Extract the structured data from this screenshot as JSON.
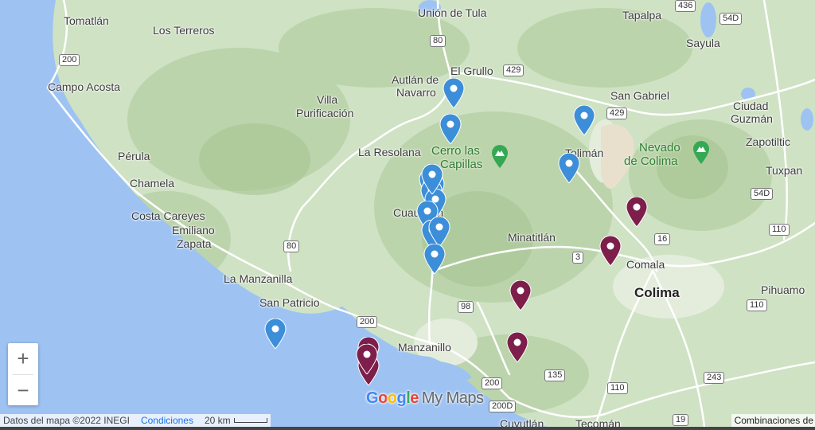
{
  "map": {
    "labels": [
      {
        "text": "Tomatlán"
      },
      {
        "text": "Los Terreros"
      },
      {
        "text": "Campo Acosta"
      },
      {
        "text": "Pérula"
      },
      {
        "text": "Chamela"
      },
      {
        "text": "Costa Careyes"
      },
      {
        "text": "Emiliano"
      },
      {
        "text": "Zapata"
      },
      {
        "text": "La Manzanilla"
      },
      {
        "text": "San Patricio"
      },
      {
        "text": "Villa"
      },
      {
        "text": "Purificación"
      },
      {
        "text": "La Resolana"
      },
      {
        "text": "Autlán de"
      },
      {
        "text": "Navarro"
      },
      {
        "text": "El Grullo"
      },
      {
        "text": "Unión de Tula"
      },
      {
        "text": "Tapalpa"
      },
      {
        "text": "Sayula"
      },
      {
        "text": "San Gabriel"
      },
      {
        "text": "Ciudad"
      },
      {
        "text": "Guzmán"
      },
      {
        "text": "Zapotiltic"
      },
      {
        "text": "Tuxpan"
      },
      {
        "text": "Tolimán"
      },
      {
        "text": "Cuautitlán"
      },
      {
        "text": "Minatitlán"
      },
      {
        "text": "Comala"
      },
      {
        "text": "Colima"
      },
      {
        "text": "Pihuamo"
      },
      {
        "text": "Manzanillo"
      },
      {
        "text": "Cuyutlán"
      },
      {
        "text": "Tecomán"
      },
      {
        "text": "Cerro las"
      },
      {
        "text": "Capillas"
      },
      {
        "text": "Nevado"
      },
      {
        "text": "de Colima"
      }
    ],
    "road_shields": [
      "436",
      "54D",
      "80",
      "200",
      "429",
      "429",
      "54D",
      "110",
      "16",
      "3",
      "98",
      "200",
      "110",
      "135",
      "200",
      "200D",
      "110",
      "243",
      "19",
      "80"
    ],
    "blue_markers": 14,
    "purple_markers": 7,
    "colors": {
      "water": "#9ec3f2",
      "land": "#cfe2c4",
      "blue_marker": "#3d8ed8",
      "purple_marker": "#7d1e4b",
      "peak": "#34a853"
    }
  },
  "zoom": {
    "in_label": "+",
    "out_label": "−"
  },
  "attribution": {
    "data": "Datos del mapa ©2022 INEGI",
    "terms": "Condiciones",
    "scale": "20 km"
  },
  "keyboard": "Combinaciones de",
  "logo": {
    "g": [
      "G",
      "o",
      "o",
      "g",
      "l",
      "e"
    ],
    "suffix": "My Maps"
  }
}
